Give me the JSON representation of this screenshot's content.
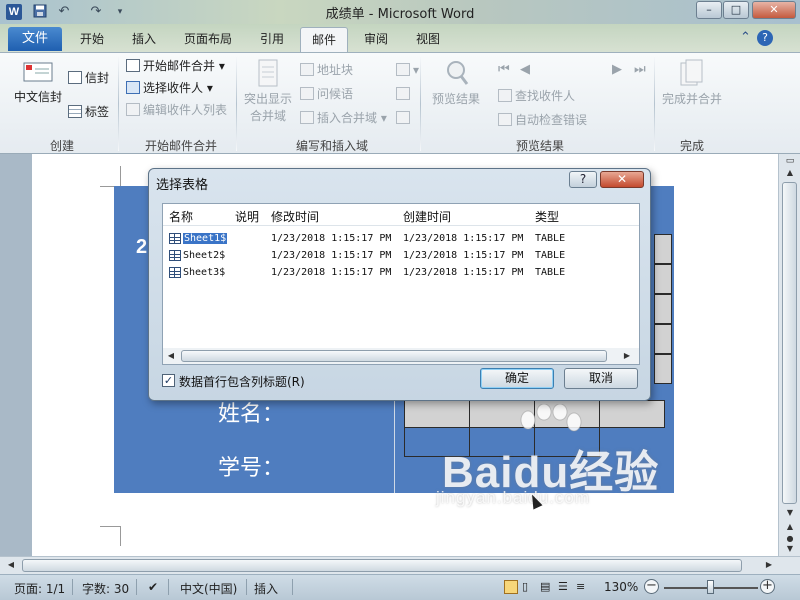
{
  "window": {
    "title": "成绩单 - Microsoft Word",
    "app_icon": "W",
    "minimize": "–",
    "maximize": "□",
    "close": "✕"
  },
  "quick_access": [
    "save-icon",
    "undo-icon",
    "redo-icon",
    "customize-icon"
  ],
  "tabs": {
    "file": "文件",
    "items": [
      {
        "label": "开始"
      },
      {
        "label": "插入"
      },
      {
        "label": "页面布局"
      },
      {
        "label": "引用"
      },
      {
        "label": "邮件",
        "active": true
      },
      {
        "label": "审阅"
      },
      {
        "label": "视图"
      }
    ]
  },
  "ribbon": {
    "create": {
      "label": "创建",
      "chinese_envelope": "中文信封",
      "envelopes": "信封",
      "labels": "标签"
    },
    "start_merge": {
      "label": "开始邮件合并",
      "start": "开始邮件合并",
      "select_recipients": "选择收件人",
      "edit_list": "编辑收件人列表"
    },
    "write_insert": {
      "label": "编写和插入域",
      "highlight": "突出显示",
      "highlight2": "合并域",
      "address_block": "地址块",
      "greeting": "问候语",
      "insert_field": "插入合并域"
    },
    "preview": {
      "label": "预览结果",
      "preview_results": "预览结果",
      "find_recipient": "查找收件人",
      "auto_check": "自动检查错误"
    },
    "finish": {
      "label": "完成",
      "finish_merge": "完成并合并"
    }
  },
  "document": {
    "number_partial": "2",
    "name_label": "姓名：",
    "id_label": "学号："
  },
  "watermark": {
    "brand": "Baidu经验",
    "url": "jingyan.baidu.com"
  },
  "dialog": {
    "title": "选择表格",
    "help": "?",
    "close": "✕",
    "columns": [
      "名称",
      "说明",
      "修改时间",
      "创建时间",
      "类型"
    ],
    "rows": [
      {
        "name": "Sheet1$",
        "desc": "",
        "modified": "1/23/2018 1:15:17 PM",
        "created": "1/23/2018 1:15:17 PM",
        "type": "TABLE",
        "selected": true
      },
      {
        "name": "Sheet2$",
        "desc": "",
        "modified": "1/23/2018 1:15:17 PM",
        "created": "1/23/2018 1:15:17 PM",
        "type": "TABLE"
      },
      {
        "name": "Sheet3$",
        "desc": "",
        "modified": "1/23/2018 1:15:17 PM",
        "created": "1/23/2018 1:15:17 PM",
        "type": "TABLE"
      }
    ],
    "checkbox_label": "数据首行包含列标题(R)",
    "checkbox_checked": true,
    "ok": "确定",
    "cancel": "取消"
  },
  "status": {
    "page": "页面: 1/1",
    "words": "字数: 30",
    "language": "中文(中国)",
    "mode": "插入",
    "zoom": "130%",
    "zoom_minus": "−",
    "zoom_plus": "+"
  }
}
